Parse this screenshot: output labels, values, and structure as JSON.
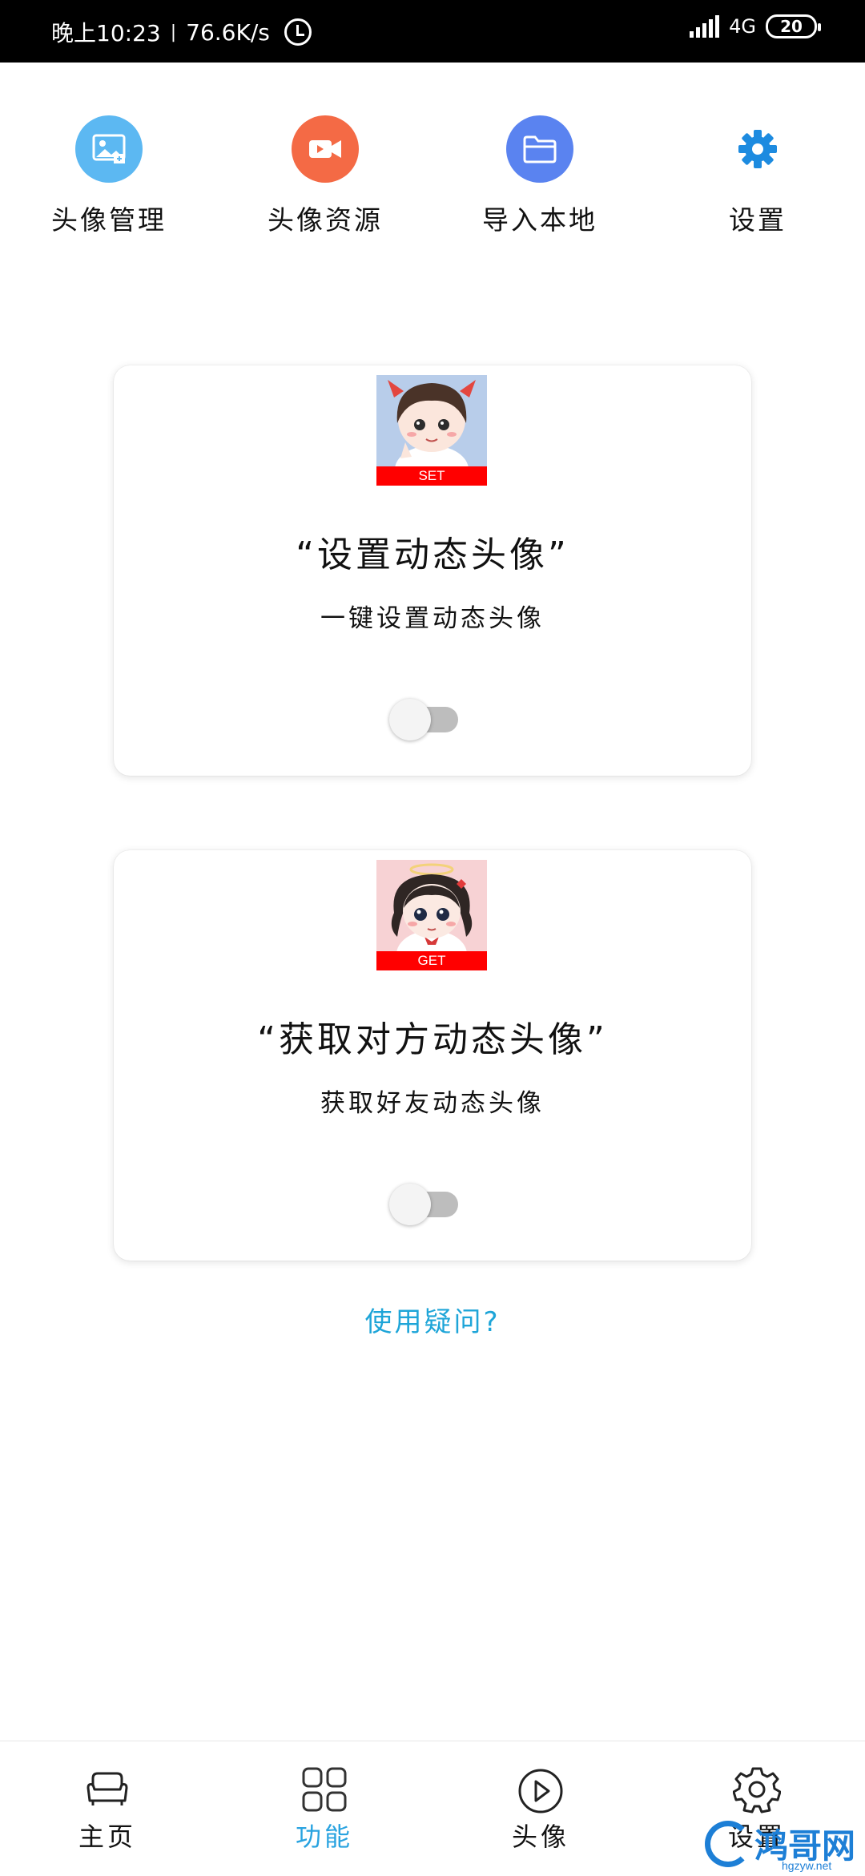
{
  "status_bar": {
    "time": "晚上10:23",
    "separator": "|",
    "speed": "76.6K/s",
    "network": "4G",
    "battery": "20"
  },
  "shortcuts": [
    {
      "label": "头像管理",
      "icon": "image-icon",
      "color": "#5cb8f2"
    },
    {
      "label": "头像资源",
      "icon": "video-icon",
      "color": "#f46a45"
    },
    {
      "label": "导入本地",
      "icon": "folder-icon",
      "color": "#5a83f0"
    },
    {
      "label": "设置",
      "icon": "gear-icon",
      "color": "#1d8be0"
    }
  ],
  "cards": [
    {
      "tag": "SET",
      "title": "“设置动态头像”",
      "subtitle": "一键设置动态头像",
      "toggle_on": false
    },
    {
      "tag": "GET",
      "title": "“获取对方动态头像”",
      "subtitle": "获取好友动态头像",
      "toggle_on": false
    }
  ],
  "help_link": "使用疑问?",
  "bottom_nav": [
    {
      "label": "主页",
      "icon": "sofa-icon",
      "active": false
    },
    {
      "label": "功能",
      "icon": "grid-icon",
      "active": true
    },
    {
      "label": "头像",
      "icon": "play-icon",
      "active": false
    },
    {
      "label": "设置",
      "icon": "gear-outline-icon",
      "active": false
    }
  ],
  "watermark": {
    "text": "鸿哥网",
    "url": "hgzyw.net"
  },
  "colors": {
    "accent": "#29a3e0",
    "help_link": "#1ea5d8",
    "tag_red": "#ff0000"
  }
}
